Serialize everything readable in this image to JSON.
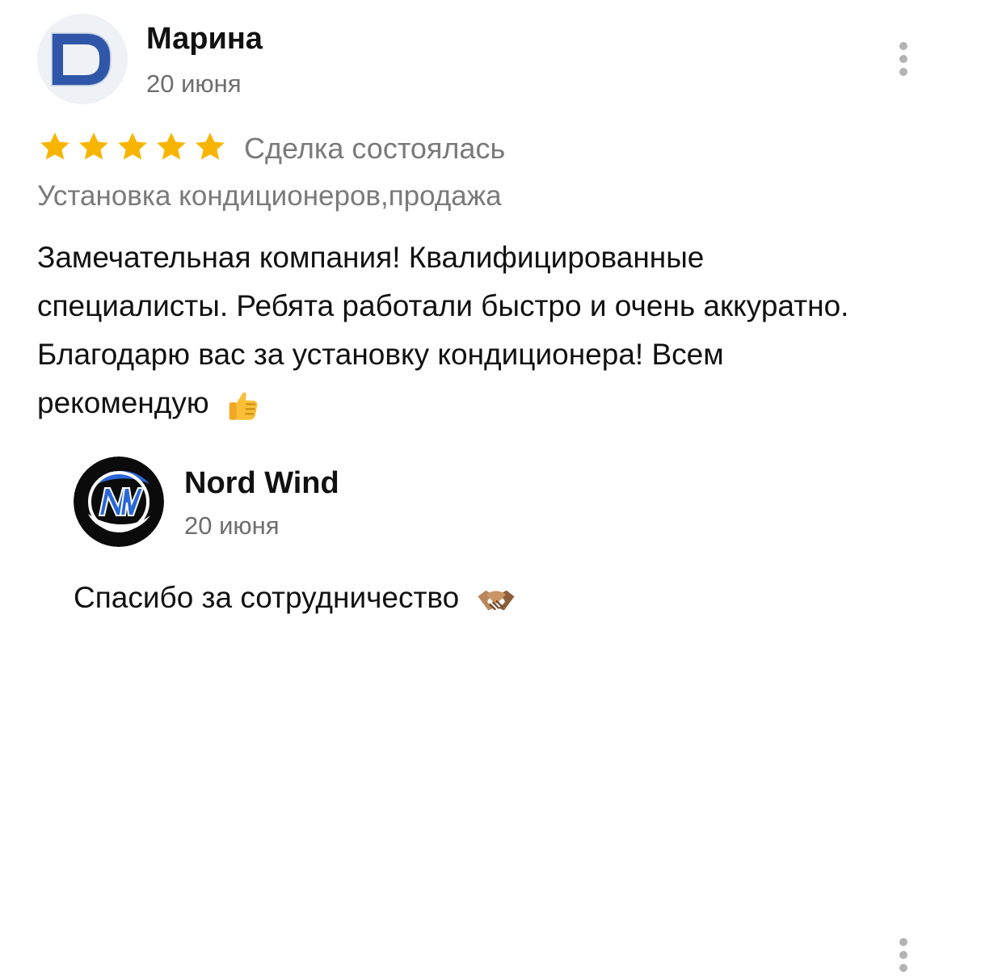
{
  "review": {
    "author": {
      "name": "Марина",
      "date": "20 июня",
      "avatar_icon": "blue-d-logo-icon"
    },
    "rating": 5,
    "deal_status": "Сделка состоялась",
    "service": "Установка кондиционеров,продажа",
    "text": "Замечательная компания! Квалифицированные специалисты. Ребята работали быстро и очень аккуратно. Благодарю вас за установку кондиционера! Всем рекомендую",
    "text_emoji": "thumbs-up-icon",
    "menu_icon": "more-vertical-icon"
  },
  "reply": {
    "author": {
      "name": "Nord Wind",
      "date": "20 июня",
      "avatar_icon": "nw-logo-icon"
    },
    "text": "Спасибо за сотрудничество",
    "text_emoji": "handshake-icon",
    "menu_icon": "more-vertical-icon"
  },
  "colors": {
    "star": "#f7b500",
    "secondary_text": "#7a7a7a",
    "menu_dots": "#b3b3b3",
    "logo_blue": "#2f56a8"
  }
}
